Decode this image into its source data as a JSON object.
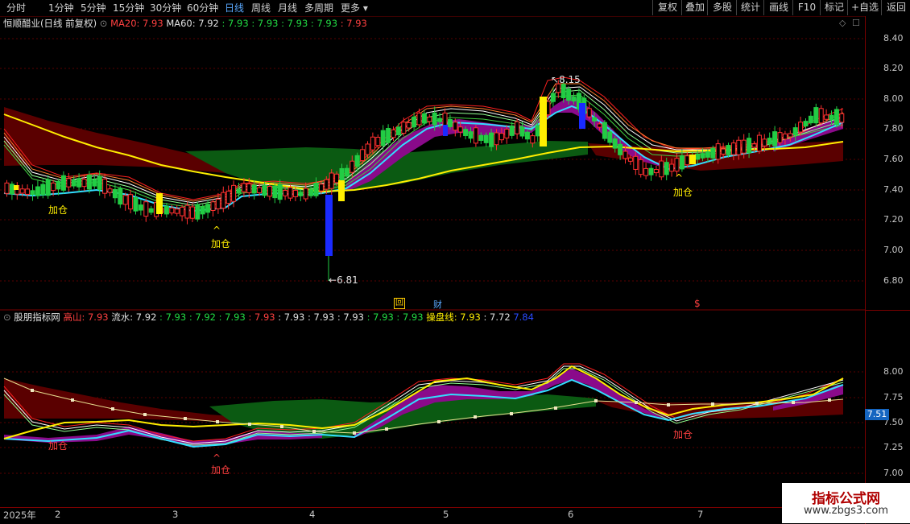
{
  "toolbar": {
    "periods": [
      "分时",
      "1分钟",
      "5分钟",
      "15分钟",
      "30分钟",
      "60分钟",
      "日线",
      "周线",
      "月线",
      "多周期",
      "更多"
    ],
    "active_period": "日线",
    "right_buttons": [
      "复权",
      "叠加",
      "多股",
      "统计",
      "画线",
      "F10",
      "标记",
      "+自选",
      "返回"
    ]
  },
  "main_panel": {
    "title": "恒顺醋业(日线 前复权)",
    "ma20_label": "MA20: 7.93",
    "ma60_label": "MA60: 7.92",
    "ma_values": [
      ": 7.93",
      ": 7.93",
      ": 7.93",
      ": 7.93",
      ": 7.93"
    ],
    "high_label": "8.15",
    "low_label": "6.81",
    "add_position_labels": [
      "加仓",
      "加仓",
      "加仓"
    ],
    "caret": "^",
    "markers": [
      "回",
      "财",
      "$"
    ],
    "y_ticks": [
      "8.40",
      "8.20",
      "8.00",
      "7.80",
      "7.60",
      "7.40",
      "7.20",
      "7.00",
      "6.80"
    ]
  },
  "sub_panel": {
    "title": "股朋指标网",
    "gaoshan_label": "高山: 7.93",
    "liushui_label": "流水: 7.92",
    "values": [
      ": 7.93",
      ": 7.92",
      ": 7.93",
      ": 7.93",
      ": 7.93",
      ": 7.93",
      ": 7.93",
      ": 7.93",
      ": 7.93"
    ],
    "caopan_label": "操盘线: 7.93",
    "extra1": ": 7.72",
    "extra2": "7.84",
    "add_position_labels": [
      "加仓",
      "加仓",
      "加仓"
    ],
    "y_ticks": [
      "8.00",
      "7.75",
      "7.50",
      "7.25",
      "7.00"
    ],
    "price_tag": "7.51"
  },
  "x_axis": {
    "labels": [
      "2025年",
      "2",
      "3",
      "4",
      "5",
      "6",
      "7"
    ]
  },
  "watermark": {
    "title": "指标公式网",
    "url": "www.zbgs3.com"
  },
  "colors": {
    "up": "#ff3030",
    "down": "#22cc44",
    "yellow_line": "#ffee00",
    "cyan_line": "#33ddff",
    "dark_red_band": "#5a0000",
    "dark_green_band": "#0b5a12",
    "purple_band": "#8a0a8a",
    "axis_red": "#7a0000"
  }
}
